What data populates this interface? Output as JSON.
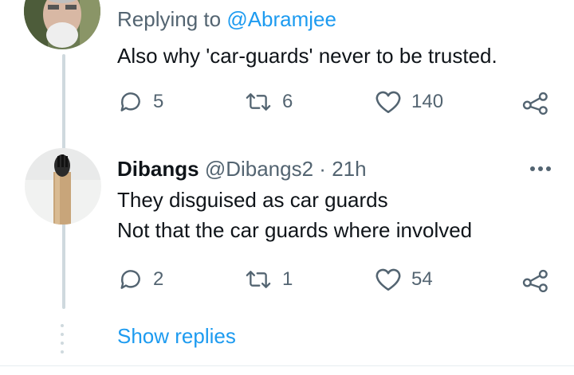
{
  "tweet1": {
    "replying_prefix": "Replying to ",
    "replying_handle": "@Abramjee",
    "text": "Also why 'car-guards' never to be trusted.",
    "replies": "5",
    "retweets": "6",
    "likes": "140"
  },
  "tweet2": {
    "author_name": "Dibangs",
    "author_handle": "@Dibangs2",
    "separator": "·",
    "time": "21h",
    "text_line1": "They disguised  as car guards",
    "text_line2": "Not that the car guards where involved",
    "replies": "2",
    "retweets": "1",
    "likes": "54"
  },
  "show_replies_label": "Show replies",
  "colors": {
    "link": "#1d9bf0",
    "muted": "#536471",
    "text": "#0f1419",
    "thread_line": "#cfd9de"
  },
  "icons": [
    "reply-icon",
    "retweet-icon",
    "like-icon",
    "share-icon",
    "more-icon"
  ]
}
